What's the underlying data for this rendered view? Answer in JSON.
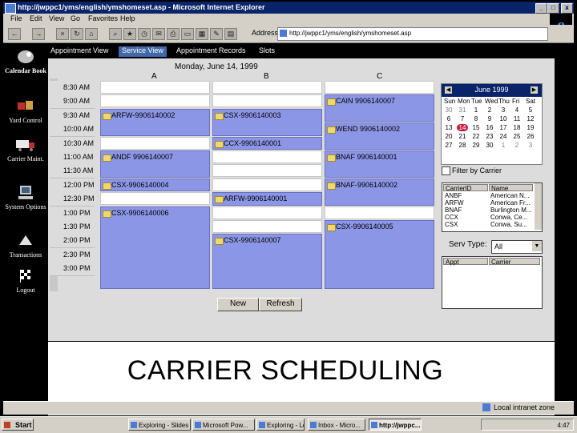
{
  "window": {
    "title": "http://jwppc1/yms/english/ymshomeset.asp - Microsoft Internet Explorer",
    "controls": [
      "_",
      "□",
      "x"
    ]
  },
  "menu": [
    "File",
    "Edit",
    "View",
    "Go",
    "Favorites",
    "Help"
  ],
  "address": {
    "label": "Address",
    "value": "http://jwppc1/yms/english/ymshomeset.asp"
  },
  "sidebar": [
    {
      "label": "Calendar Book",
      "icon": "calendar-book-icon"
    },
    {
      "label": "Yard Control",
      "icon": "yard-control-icon"
    },
    {
      "label": "Carrier Maint.",
      "icon": "truck-icon"
    },
    {
      "label": "System Options",
      "icon": "computer-icon"
    },
    {
      "label": "Transactions",
      "icon": "transactions-icon"
    },
    {
      "label": "Logout",
      "icon": "checkered-flag-icon"
    }
  ],
  "tabs": [
    "Appointment View",
    "Service View",
    "Appointment Records",
    "Slots"
  ],
  "active_tab": "Service View",
  "schedule": {
    "day": "Monday, June 14, 1999",
    "columns": [
      "A",
      "B",
      "C"
    ],
    "times": [
      "8:30 AM",
      "9:00 AM",
      "9:30 AM",
      "10:00 AM",
      "10:30 AM",
      "11:00 AM",
      "11:30 AM",
      "12:00 PM",
      "12:30 PM",
      "1:00 PM",
      "1:30 PM",
      "2:00 PM",
      "2:30 PM",
      "3:00 PM"
    ],
    "appointments": [
      {
        "label": "ARFW-9906140002",
        "col": 0,
        "start": 2,
        "span": 2
      },
      {
        "label": "ANDF 9906140007",
        "col": 0,
        "start": 5,
        "span": 2
      },
      {
        "label": "CSX-9906140004",
        "col": 0,
        "start": 7,
        "span": 1
      },
      {
        "label": "CSX-9906140006",
        "col": 0,
        "start": 9,
        "span": 6
      },
      {
        "label": "CSX-9906140003",
        "col": 1,
        "start": 2,
        "span": 2
      },
      {
        "label": "CCX-9906140001",
        "col": 1,
        "start": 4,
        "span": 1
      },
      {
        "label": "ARFW-9906140001",
        "col": 1,
        "start": 8,
        "span": 1
      },
      {
        "label": "CSX-9906140007",
        "col": 1,
        "start": 11,
        "span": 4
      },
      {
        "label": "CAIN 9906140007",
        "col": 2,
        "start": 1,
        "span": 2
      },
      {
        "label": "WEND 9906140002",
        "col": 2,
        "start": 3,
        "span": 2
      },
      {
        "label": "BNAF 9906140001",
        "col": 2,
        "start": 5,
        "span": 2
      },
      {
        "label": "BNAF-9906140002",
        "col": 2,
        "start": 7,
        "span": 2
      },
      {
        "label": "CSX-9906140005",
        "col": 2,
        "start": 10,
        "span": 5
      }
    ]
  },
  "buttons": {
    "new": "New",
    "refresh": "Refresh"
  },
  "calendar": {
    "month": "June 1999",
    "dow": [
      "Sun",
      "Mon",
      "Tue",
      "Wed",
      "Thu",
      "Fri",
      "Sat"
    ],
    "weeks": [
      [
        "30",
        "31",
        "1",
        "2",
        "3",
        "4",
        "5"
      ],
      [
        "6",
        "7",
        "8",
        "9",
        "10",
        "11",
        "12"
      ],
      [
        "13",
        "14",
        "15",
        "16",
        "17",
        "18",
        "19"
      ],
      [
        "20",
        "21",
        "22",
        "23",
        "24",
        "25",
        "26"
      ],
      [
        "27",
        "28",
        "29",
        "30",
        "1",
        "2",
        "3"
      ]
    ],
    "selected": "14"
  },
  "filter": {
    "label": "Filter by Carrier"
  },
  "carrier_list": {
    "headers": [
      "CarrierID",
      "Name"
    ],
    "rows": [
      [
        "ANBF",
        "American N..."
      ],
      [
        "ARFW",
        "American Fr..."
      ],
      [
        "BNAF",
        "Burlington M..."
      ],
      [
        "CCX",
        "Conwa, Ce..."
      ],
      [
        "CSX",
        "Conwa, Su..."
      ]
    ]
  },
  "service_type": {
    "label": "Serv Type:",
    "value": "All"
  },
  "appt_list": {
    "headers": [
      "Appt",
      "Carrier"
    ]
  },
  "page_title": "CARRIER SCHEDULING",
  "status": {
    "zone": "Local intranet zone"
  },
  "taskbar": {
    "start": "Start",
    "items": [
      "Exploring - Slides",
      "Microsoft Pow...",
      "Exploring - Lon...",
      "Inbox - Micro...",
      "http://jwppc..."
    ],
    "active": "http://jwppc...",
    "clock": "4:47"
  }
}
